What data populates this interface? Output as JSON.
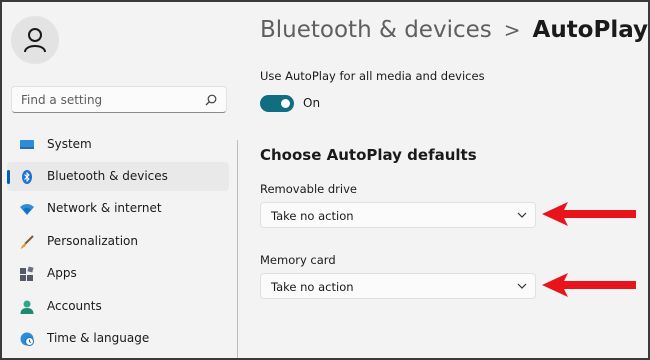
{
  "sidebar": {
    "avatar": "user-icon",
    "search": {
      "placeholder": "Find a setting",
      "icon": "search-icon"
    },
    "items": [
      {
        "label": "System",
        "icon": "monitor-icon",
        "active": false
      },
      {
        "label": "Bluetooth & devices",
        "icon": "bluetooth-icon",
        "active": true
      },
      {
        "label": "Network & internet",
        "icon": "wifi-icon",
        "active": false
      },
      {
        "label": "Personalization",
        "icon": "brush-icon",
        "active": false
      },
      {
        "label": "Apps",
        "icon": "apps-icon",
        "active": false
      },
      {
        "label": "Accounts",
        "icon": "person-icon",
        "active": false
      },
      {
        "label": "Time & language",
        "icon": "globe-clock-icon",
        "active": false
      }
    ]
  },
  "header": {
    "parent": "Bluetooth & devices",
    "separator": ">",
    "current": "AutoPlay"
  },
  "autoplay_toggle": {
    "label": "Use AutoPlay for all media and devices",
    "state_text": "On",
    "on": true
  },
  "defaults": {
    "title": "Choose AutoPlay defaults",
    "removable_drive": {
      "label": "Removable drive",
      "value": "Take no action"
    },
    "memory_card": {
      "label": "Memory card",
      "value": "Take no action"
    }
  },
  "colors": {
    "accent": "#005fb8",
    "toggle_on": "#0f6e80",
    "annotation_arrow": "#e8141b"
  }
}
